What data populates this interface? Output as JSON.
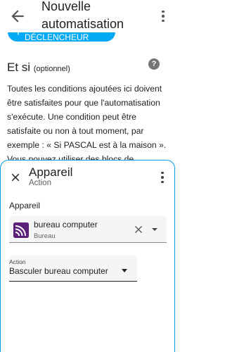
{
  "header": {
    "title": "Nouvelle automatisation",
    "back_icon": "arrow-left-icon",
    "menu_icon": "dots-vertical-icon"
  },
  "trigger_button": {
    "label": "Ajouter un déclencheur",
    "icon": "plus-icon",
    "color": "#03a9f4"
  },
  "conditions": {
    "title": "Et si",
    "optional": "(optionnel)",
    "help_icon": "help-circle-icon",
    "description": "Toutes les conditions ajoutées ici doivent être satisfaites pour que l'automatisation s'exécute. Une condition peut être satisfaite ou non à tout moment, par exemple : « Si PASCAL est à la maison ». Vous pouvez utiliser des blocs de construction pour créer"
  },
  "dialog": {
    "title": "Appareil",
    "subtitle": "Action",
    "close_icon": "close-icon",
    "menu_icon": "dots-vertical-icon",
    "border_color": "#039be5",
    "device_section_label": "Appareil",
    "device_field": {
      "icon": "wifi-device-icon",
      "icon_color": "#5b1f7a",
      "name": "bureau computer",
      "area": "Bureau",
      "clear_icon": "close-icon",
      "dropdown_icon": "menu-down-icon"
    },
    "action_field": {
      "label": "Action",
      "value": "Basculer bureau computer",
      "dropdown_icon": "menu-down-icon"
    }
  }
}
